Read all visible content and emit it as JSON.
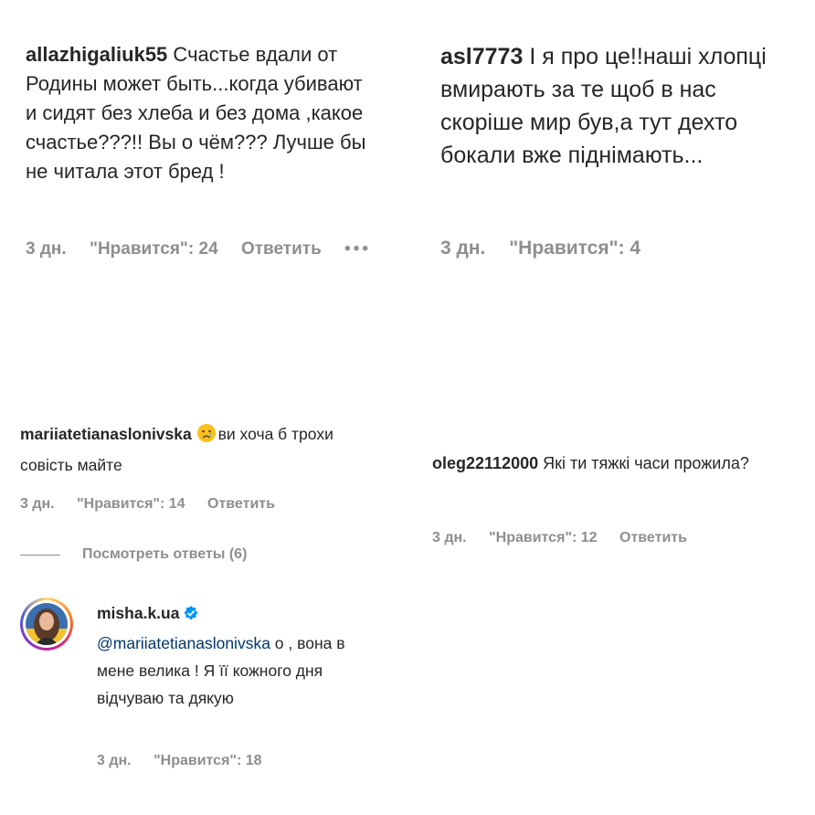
{
  "comments": [
    {
      "username": "allazhigaliuk55",
      "text": "Счастье вдали от Родины может быть...когда убивают и сидят без хлеба и без дома ,какое счастье???!! Вы о чём??? Лучше бы не читала этот бред !",
      "time": "3 дн.",
      "likes": "\"Нравится\": 24",
      "reply": "Ответить",
      "more": "•••"
    },
    {
      "username": "asl7773",
      "text": "І я про це!!наші хлопці вмирають за те щоб в нас скоріше мир був,а тут дехто бокали вже піднімають...",
      "time": "3 дн.",
      "likes": "\"Нравится\": 4"
    },
    {
      "username": "mariiatetianaslonivska",
      "emoji": "crying-face",
      "text": "ви хоча б трохи совість майте",
      "time": "3 дн.",
      "likes": "\"Нравится\": 14",
      "reply": "Ответить",
      "view_replies": "Посмотреть ответы (6)"
    },
    {
      "username": "oleg22112000",
      "text": "Які ти тяжкі часи прожила?",
      "time": "3 дн.",
      "likes": "\"Нравится\": 12",
      "reply": "Ответить"
    }
  ],
  "reply_comment": {
    "username": "misha.k.ua",
    "verified": true,
    "mention": "@mariiatetianaslonivska",
    "text": " о , вона в мене велика ! Я її кожного дня відчуваю та дякую",
    "time": "3 дн.",
    "likes": "\"Нравится\": 18"
  },
  "colors": {
    "text": "#262626",
    "meta": "#8e8e8e",
    "mention": "#00376b",
    "verified": "#0095f6"
  }
}
